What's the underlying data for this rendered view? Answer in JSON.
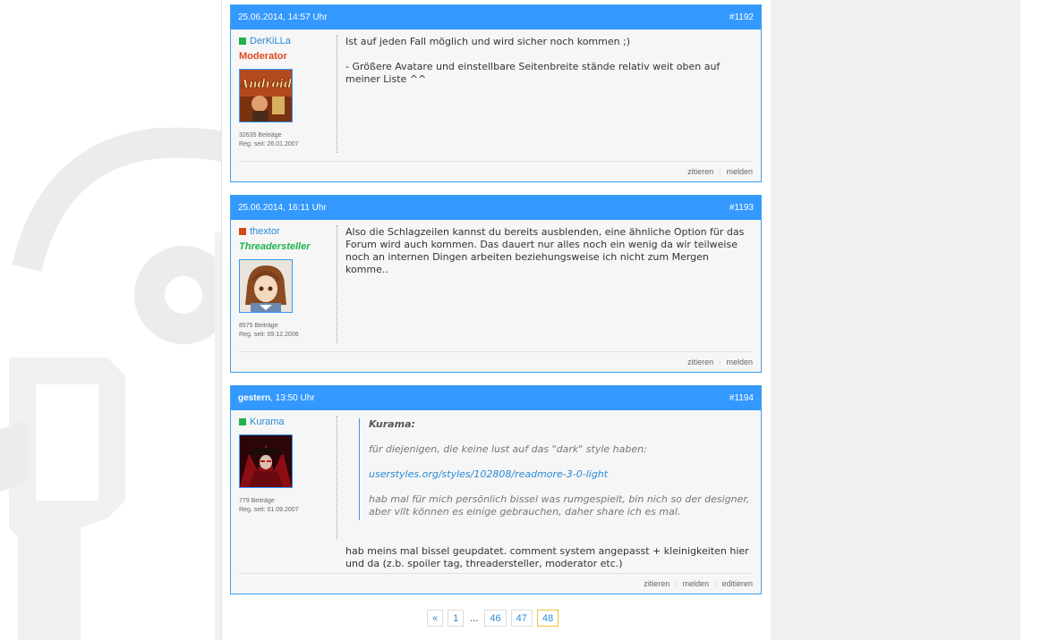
{
  "posts": [
    {
      "date": "25.06.2014, 14:57 Uhr",
      "number": "#1192",
      "author": "DerKiLLa",
      "status_color": "#22b24c",
      "role": "Moderator",
      "avatar_text": "Android",
      "posts_count": "32635 Beiträge",
      "reg_date": "Reg. seit: 26.01.2007",
      "paragraphs": [
        "Ist auf jeden Fall möglich und wird sicher noch kommen ;)",
        "- Größere Avatare und einstellbare Seitenbreite stände relativ weit oben auf meiner Liste ^^"
      ],
      "actions": [
        "zitieren",
        "melden"
      ]
    },
    {
      "date": "25.06.2014, 16:11 Uhr",
      "number": "#1193",
      "author": "thextor",
      "status_color": "#d04a1a",
      "role": "Threadersteller",
      "posts_count": "8575 Beiträge",
      "reg_date": "Reg. seit: 09.12.2006",
      "paragraphs": [
        "Also die Schlagzeilen kannst du bereits ausblenden, eine ähnliche Option für das Forum wird auch kommen. Das dauert nur alles noch ein wenig da wir teilweise noch an internen Dingen arbeiten beziehungsweise ich nicht zum Mergen komme.."
      ],
      "actions": [
        "zitieren",
        "melden"
      ]
    },
    {
      "date_bold": "gestern",
      "date_rest": ", 13:50 Uhr",
      "number": "#1194",
      "author": "Kurama",
      "status_color": "#22b24c",
      "posts_count": "779 Beiträge",
      "reg_date": "Reg. seit: 01.09.2007",
      "quote": {
        "author": "Kurama:",
        "line1": "für diejenigen, die keine lust auf das \"dark\" style haben:",
        "link": "userstyles.org/styles/102808/readmore-3-0-light",
        "line2": "hab mal für mich persönlich bissel was rumgespielt, bin nich so der designer, aber vllt können es einige gebrauchen, daher share ich es mal."
      },
      "paragraphs": [
        "hab meins mal bissel geupdatet. comment system angepasst + kleinigkeiten hier und da (z.b. spoiler tag, threadersteller, moderator etc.)"
      ],
      "actions": [
        "zitieren",
        "melden",
        "editieren"
      ]
    }
  ],
  "pagination": {
    "prev": "«",
    "first": "1",
    "ellipsis": "...",
    "pages": [
      "46",
      "47"
    ],
    "current": "48"
  }
}
